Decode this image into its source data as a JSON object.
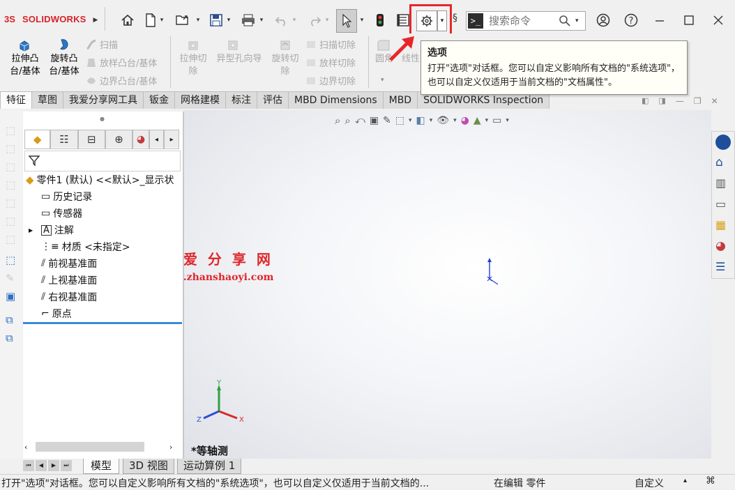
{
  "app": {
    "logo_text": "SOLIDWORKS",
    "search_placeholder": "搜索命令"
  },
  "ribbon": {
    "extrude_boss": "拉伸凸\n台/基体",
    "revolve_boss": "旋转凸\n台/基体",
    "sweep": "扫描",
    "loft_boss": "放样凸台/基体",
    "boundary_boss": "边界凸台/基体",
    "extrude_cut": "拉伸切\n除",
    "hole_wizard": "异型孔向导",
    "revolve_cut": "旋转切\n除",
    "swept_cut": "扫描切除",
    "lofted_cut": "放样切除",
    "boundary_cut": "边界切除",
    "fillet": "圆角",
    "linear_pattern": "线性"
  },
  "tooltip": {
    "title": "选项",
    "body": "打开\"选项\"对话框。您可以自定义影响所有文档的\"系统选项\"，也可以自定义仅适用于当前文档的\"文档属性\"。"
  },
  "tabs": [
    "特征",
    "草图",
    "我爱分享网工具",
    "钣金",
    "网格建模",
    "标注",
    "评估",
    "MBD Dimensions",
    "MBD",
    "SOLIDWORKS Inspection"
  ],
  "tree": {
    "root": "零件1 (默认) <<默认>_显示状",
    "items": [
      "历史记录",
      "传感器",
      "注解",
      "材质 <未指定>",
      "前视基准面",
      "上视基准面",
      "右视基准面",
      "原点"
    ]
  },
  "watermark": {
    "title": "我 爱 分 享 网",
    "url": "www.zhanshaoyi.com"
  },
  "viewport": {
    "view_label": "*等轴测",
    "triad_y": "Y",
    "triad_x": "X",
    "triad_z": "Z"
  },
  "bottom_tabs": [
    "模型",
    "3D 视图",
    "运动算例 1"
  ],
  "status": {
    "message": "打开\"选项\"对话框。您可以自定义影响所有文档的\"系统选项\"，也可以自定义仅适用于当前文档的...",
    "editing": "在编辑 零件",
    "units": "自定义"
  },
  "colors": {
    "highlight_red": "#e8262a",
    "watermark_red": "#e0262a",
    "selection_blue": "#3a8ad6"
  }
}
